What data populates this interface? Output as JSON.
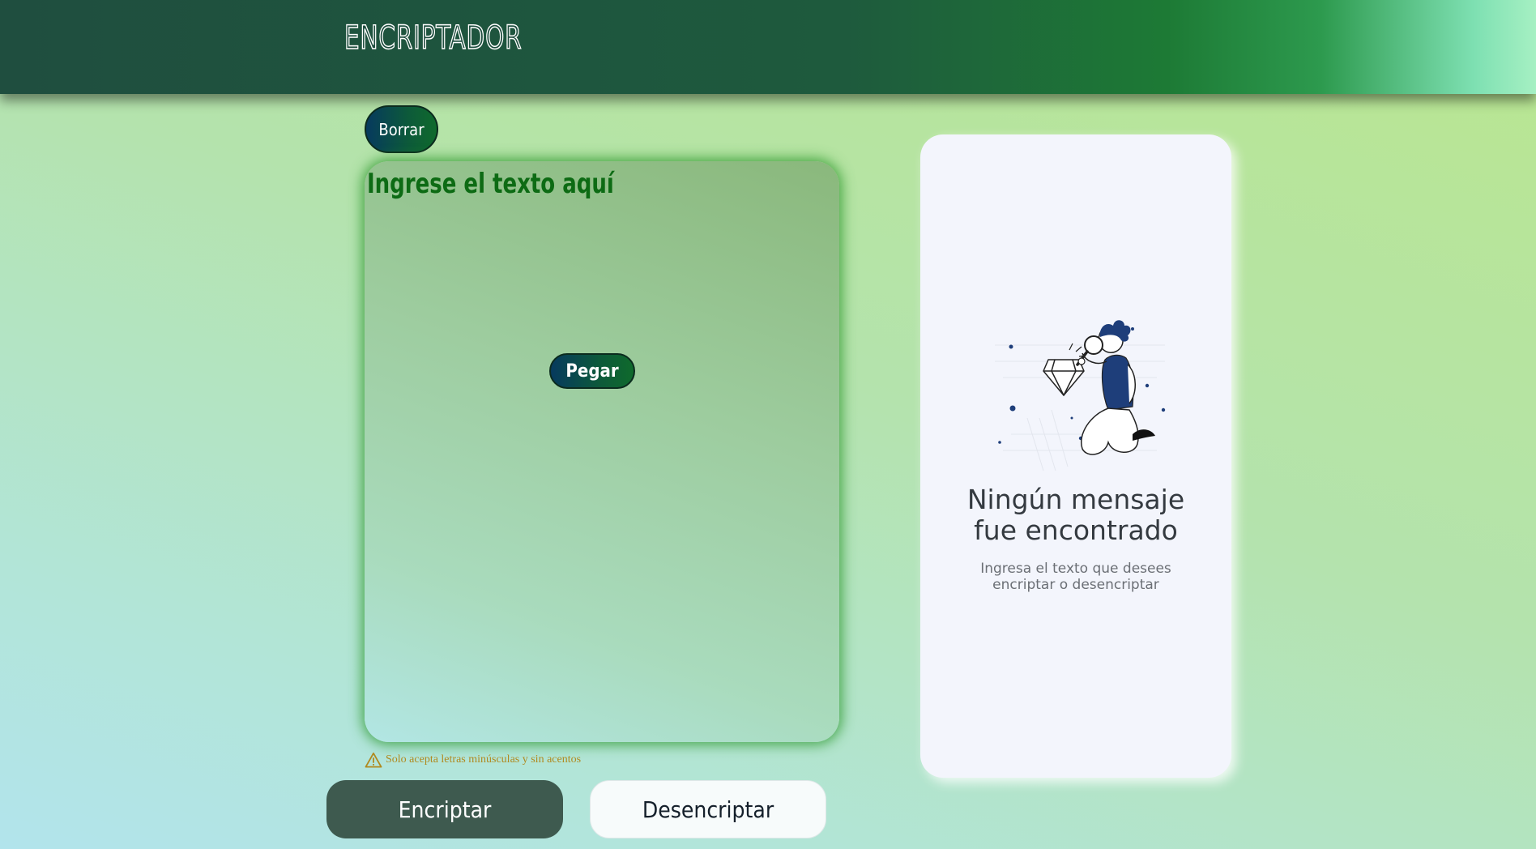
{
  "header": {
    "logo_text": "ENCRIPTADOR"
  },
  "toolbar": {
    "clear_label": "Borrar",
    "paste_label": "Pegar"
  },
  "input": {
    "placeholder": "Ingrese el texto aquí"
  },
  "warning": {
    "text": "Solo acepta letras minúsculas y sin acentos",
    "icon": "warning-triangle-icon"
  },
  "actions": {
    "encrypt_label": "Encriptar",
    "decrypt_label": "Desencriptar"
  },
  "output": {
    "title_line1": "Ningún mensaje",
    "title_line2": "fue encontrado",
    "subtitle_line1": "Ingresa el texto que desees",
    "subtitle_line2": "encriptar o desencriptar",
    "illustration": "person-with-magnifier-and-diamond"
  },
  "colors": {
    "header_dark": "#1f4e3f",
    "placeholder_green": "#0d6b14",
    "encrypt_button": "#3e5a4f",
    "decrypt_button": "#f7fbfb",
    "warning": "#b08a1f",
    "output_card": "#f3f5fc"
  }
}
